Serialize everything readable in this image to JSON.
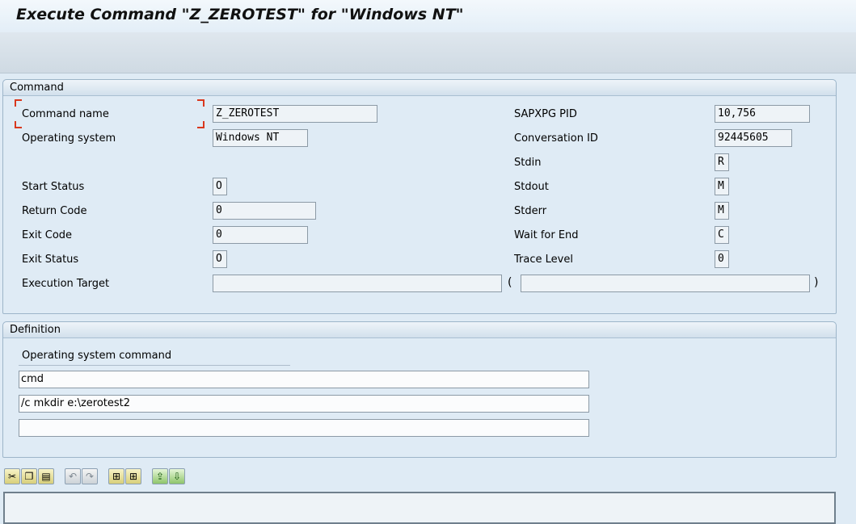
{
  "title": "Execute Command \"Z_ZEROTEST\" for \"Windows NT\"",
  "command_group": {
    "header": "Command",
    "left": [
      {
        "label": "Command name",
        "value": "Z_ZEROTEST"
      },
      {
        "label": "Operating system",
        "value": "Windows NT"
      },
      {
        "label": "Start Status",
        "value": "O"
      },
      {
        "label": "Return Code",
        "value": "0"
      },
      {
        "label": "Exit Code",
        "value": "0"
      },
      {
        "label": "Exit Status",
        "value": "O"
      },
      {
        "label": "Execution Target",
        "value": ""
      }
    ],
    "right": [
      {
        "label": "SAPXPG PID",
        "value": "10,756"
      },
      {
        "label": "Conversation ID",
        "value": "92445605"
      },
      {
        "label": "Stdin",
        "value": "R"
      },
      {
        "label": "Stdout",
        "value": "M"
      },
      {
        "label": "Stderr",
        "value": "M"
      },
      {
        "label": "Wait for End",
        "value": "C"
      },
      {
        "label": "Trace Level",
        "value": "0"
      }
    ],
    "open_paren": "(",
    "close_paren": ")",
    "execution_target_extra": ""
  },
  "definition_group": {
    "header": "Definition",
    "os_command_label": "Operating system command",
    "lines": [
      "cmd",
      "/c mkdir e:\\zerotest2",
      ""
    ]
  },
  "toolbar_icons": [
    {
      "name": "cut-icon",
      "glyph": "✂"
    },
    {
      "name": "copy-icon",
      "glyph": "❐"
    },
    {
      "name": "paste-icon",
      "glyph": "▤"
    },
    {
      "name": "undo-icon",
      "glyph": "↶"
    },
    {
      "name": "redo-icon",
      "glyph": "↷"
    },
    {
      "name": "find-icon",
      "glyph": "⊞"
    },
    {
      "name": "find-next-icon",
      "glyph": "⊞"
    },
    {
      "name": "upload-icon",
      "glyph": "⇪"
    },
    {
      "name": "download-icon",
      "glyph": "⇩"
    }
  ]
}
